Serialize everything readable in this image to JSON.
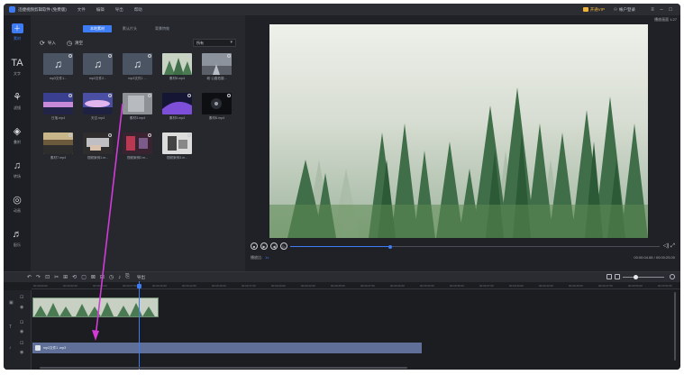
{
  "titlebar": {
    "app_name": "迅捷视频剪辑软件 (免费版)",
    "menu": [
      "文件",
      "编辑",
      "导出",
      "帮助"
    ],
    "vip_label": "开通VIP",
    "account_label": "帐户登录",
    "window_controls": [
      "≡",
      "–",
      "□"
    ]
  },
  "leftnav": {
    "items": [
      {
        "icon": "import-icon",
        "glyph": "＋",
        "label": "素材"
      },
      {
        "icon": "text-icon",
        "glyph": "TA",
        "label": "文字"
      },
      {
        "icon": "filter-icon",
        "glyph": "⚘",
        "label": "滤镜"
      },
      {
        "icon": "layers-icon",
        "glyph": "◈",
        "label": "叠附"
      },
      {
        "icon": "transition-icon",
        "glyph": "♫",
        "label": "转场"
      },
      {
        "icon": "element-icon",
        "glyph": "◎",
        "label": "动画"
      },
      {
        "icon": "music-icon",
        "glyph": "♬",
        "label": "配乐"
      }
    ]
  },
  "media": {
    "tabs": [
      "本地素材",
      "默认片头",
      "背景特效"
    ],
    "import_label": "导入",
    "clear_label": "清空",
    "select_value": "所有",
    "items": [
      {
        "name": "mp3文件1...",
        "kind": "audio"
      },
      {
        "name": "mp3文件2...",
        "kind": "audio"
      },
      {
        "name": "mp3文件1 ...",
        "kind": "audio"
      },
      {
        "name": "素材8.mp4",
        "kind": "forest"
      },
      {
        "name": "城·公路拍摄...",
        "kind": "road"
      },
      {
        "name": "日落.mp4",
        "kind": "sunset"
      },
      {
        "name": "天空.mp4",
        "kind": "sunset2"
      },
      {
        "name": "素材3.mp4",
        "kind": "gray"
      },
      {
        "name": "素材5.mp4",
        "kind": "purple"
      },
      {
        "name": "素材6.mp4",
        "kind": "dark"
      },
      {
        "name": "素材7.mp4",
        "kind": "landscape"
      },
      {
        "name": "视频案例1.m...",
        "kind": "hands"
      },
      {
        "name": "视频案例2.m...",
        "kind": "red"
      },
      {
        "name": "视频案例3.m...",
        "kind": "bw"
      }
    ]
  },
  "preview": {
    "label": "播放画面 1:27",
    "speed_label": "播放比:",
    "speed_value": "1x",
    "timecode": "00:00:04.65 / 00:00:25.00",
    "progress": 0.27,
    "volume_icons": "◁) ⤢"
  },
  "toolbar": {
    "tools": [
      "↶",
      "↷",
      "⊡",
      "✂",
      "⊞",
      "⟲",
      "▢",
      "⊠",
      "⊟",
      "◷",
      "♪",
      "⎘"
    ],
    "export_label": "导出"
  },
  "timeline": {
    "ruler": [
      "00:00:00.00",
      "00:00:02.50",
      "00:00:05.00",
      "00:00:07.50",
      "00:00:10.00",
      "00:00:12.50",
      "00:00:15.00",
      "00:00:17.50",
      "00:00:20.00",
      "00:00:22.50",
      "00:00:25.00",
      "00:00:27.50",
      "00:00:30.00",
      "00:00:32.50",
      "00:00:35.00",
      "00:00:37.50",
      "00:00:40.00",
      "00:00:42.50",
      "00:00:45.00",
      "00:00:47.50",
      "00:00:50.00",
      "00:00:52.50"
    ],
    "audio_clip_name": "mp3文件1 .mp3"
  },
  "colors": {
    "accent": "#3d7cf4",
    "annotation": "#d33ad8"
  }
}
